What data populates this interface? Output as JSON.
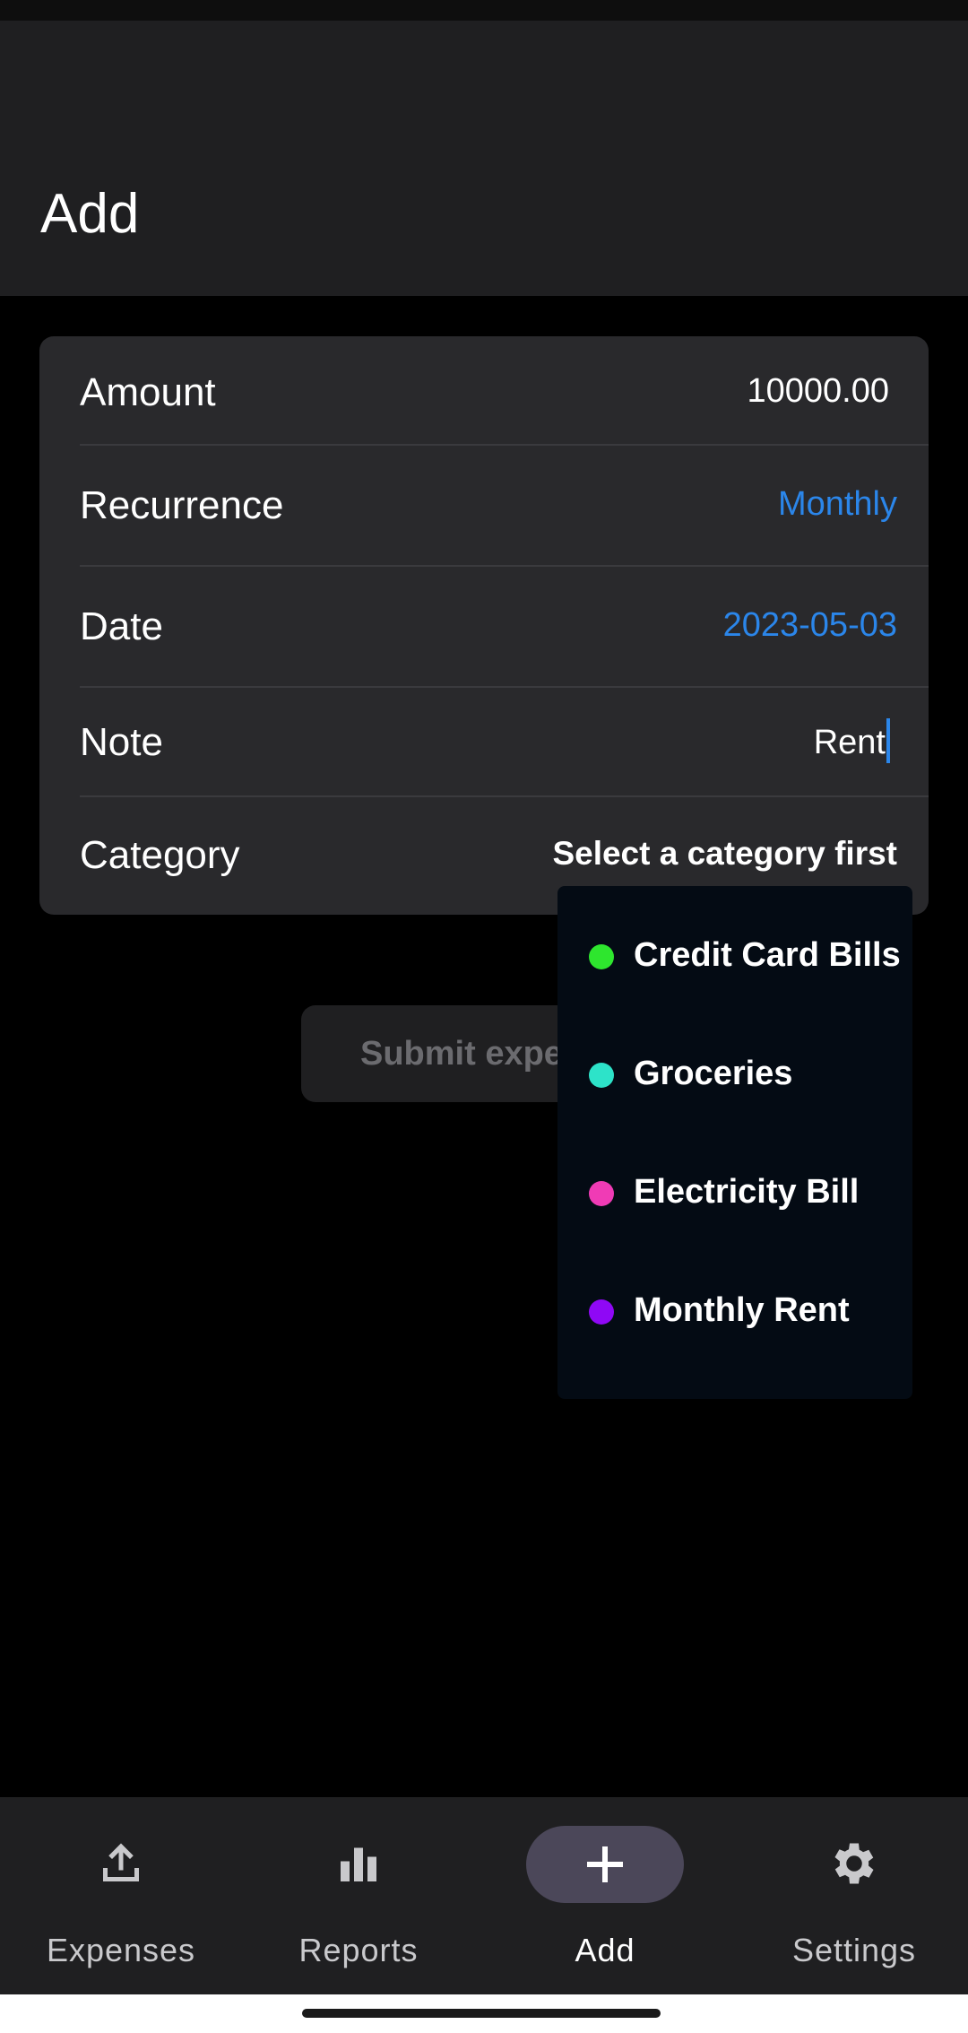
{
  "header": {
    "title": "Add"
  },
  "form": {
    "amount": {
      "label": "Amount",
      "value": "10000.00"
    },
    "recurrence": {
      "label": "Recurrence",
      "value": "Monthly"
    },
    "date": {
      "label": "Date",
      "value": "2023-05-03"
    },
    "note": {
      "label": "Note",
      "value": "Rent"
    },
    "category": {
      "label": "Category",
      "value": "Select a category first"
    }
  },
  "submit": {
    "label": "Submit exper"
  },
  "category_dropdown": {
    "items": [
      {
        "label": "Credit Card Bills",
        "color": "#2ee62e"
      },
      {
        "label": "Groceries",
        "color": "#2de3c9"
      },
      {
        "label": "Electricity Bill",
        "color": "#f03bb5"
      },
      {
        "label": "Monthly Rent",
        "color": "#8f08f5"
      }
    ]
  },
  "bottom_nav": {
    "items": [
      {
        "label": "Expenses",
        "icon": "upload-icon"
      },
      {
        "label": "Reports",
        "icon": "bar-chart-icon"
      },
      {
        "label": "Add",
        "icon": "plus-icon",
        "active": true
      },
      {
        "label": "Settings",
        "icon": "gear-icon"
      }
    ]
  },
  "colors": {
    "accent": "#2b86ea",
    "card": "#29292c",
    "header": "#1f1f21",
    "active_pill": "#4b4759"
  }
}
